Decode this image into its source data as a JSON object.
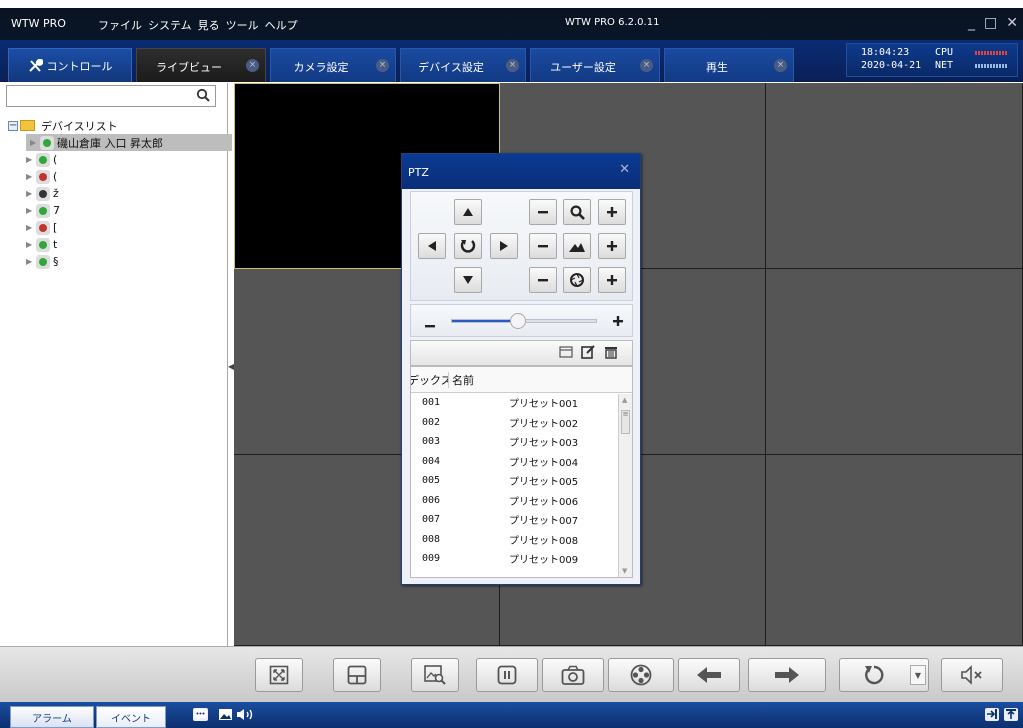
{
  "titlebar": {
    "app_name": "WTW PRO",
    "menus": [
      "ファイル",
      "システム",
      "見る",
      "ツール",
      "ヘルプ"
    ],
    "version": "WTW PRO 6.2.0.11",
    "minimize_glyph": "_",
    "maximize_glyph": "□",
    "close_glyph": "✕"
  },
  "tabs": {
    "control": "コントロール",
    "live": "ライブビュー",
    "camera": "カメラ設定",
    "device": "デバイス設定",
    "user": "ユーザー設定",
    "playback": "再生",
    "close_glyph": "×"
  },
  "sysstat": {
    "time": "18:04:23",
    "date": "2020-04-21",
    "cpu_label": "CPU",
    "net_label": "NET"
  },
  "sidebar": {
    "search_placeholder": "",
    "root_label": "デバイスリスト",
    "selected_device": "磯山倉庫 入口 昇太郎",
    "devices": [
      {
        "label": "(",
        "status": "green"
      },
      {
        "label": "(",
        "status": "red"
      },
      {
        "label": "ž",
        "status": "black"
      },
      {
        "label": "7",
        "status": "green"
      },
      {
        "label": "[",
        "status": "red"
      },
      {
        "label": "t",
        "status": "green"
      },
      {
        "label": "§",
        "status": "green"
      }
    ]
  },
  "ptz": {
    "title": "PTZ",
    "close_glyph": "✕",
    "speed_level": 0.45,
    "col_index_header": "インデックス",
    "col_name_header": "名前",
    "presets": [
      {
        "index": "001",
        "name": "プリセット001"
      },
      {
        "index": "002",
        "name": "プリセット002"
      },
      {
        "index": "003",
        "name": "プリセット003"
      },
      {
        "index": "004",
        "name": "プリセット004"
      },
      {
        "index": "005",
        "name": "プリセット005"
      },
      {
        "index": "006",
        "name": "プリセット006"
      },
      {
        "index": "007",
        "name": "プリセット007"
      },
      {
        "index": "008",
        "name": "プリセット008"
      },
      {
        "index": "009",
        "name": "プリセット009"
      }
    ]
  },
  "statusbar": {
    "alarm": "アラーム",
    "event": "イベント"
  }
}
